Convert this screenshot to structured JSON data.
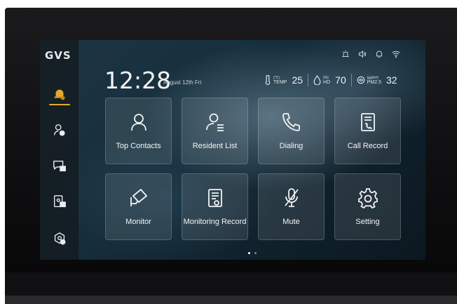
{
  "sidebar": {
    "logo": "GVS",
    "items": [
      {
        "icon": "bell-icon",
        "active": true
      },
      {
        "icon": "intercom-user-icon",
        "active": false
      },
      {
        "icon": "message-icon",
        "active": false
      },
      {
        "icon": "door-panel-icon",
        "active": false
      },
      {
        "icon": "settings-hex-icon",
        "active": false
      }
    ]
  },
  "header": {
    "time": "12:28",
    "date": "August 12th  Fri",
    "status_icons": [
      "alarm-icon",
      "speaker-icon",
      "bell-off-icon",
      "wifi-icon"
    ],
    "env": {
      "temp": {
        "unit": "(℃)",
        "label": "TEMP",
        "value": "25"
      },
      "humidity": {
        "unit": "(%)",
        "label": "HD",
        "value": "70"
      },
      "pm": {
        "unit": "(μg/m³)",
        "label": "PM2.5",
        "value": "32"
      }
    }
  },
  "tiles": [
    {
      "label": "Top Contacts",
      "icon": "person-icon"
    },
    {
      "label": "Resident List",
      "icon": "resident-list-icon"
    },
    {
      "label": "Dialing",
      "icon": "phone-icon"
    },
    {
      "label": "Call Record",
      "icon": "call-record-icon"
    },
    {
      "label": "Monitor",
      "icon": "camera-icon"
    },
    {
      "label": "Monitoring Record",
      "icon": "monitoring-record-icon"
    },
    {
      "label": "Mute",
      "icon": "mic-off-icon"
    },
    {
      "label": "Setting",
      "icon": "gear-icon"
    }
  ],
  "pager": {
    "pages": 2,
    "current": 1
  },
  "colors": {
    "accent": "#e3a92d",
    "text": "#f2f4f6",
    "tile_bg": "rgba(255,255,255,0.10)"
  }
}
